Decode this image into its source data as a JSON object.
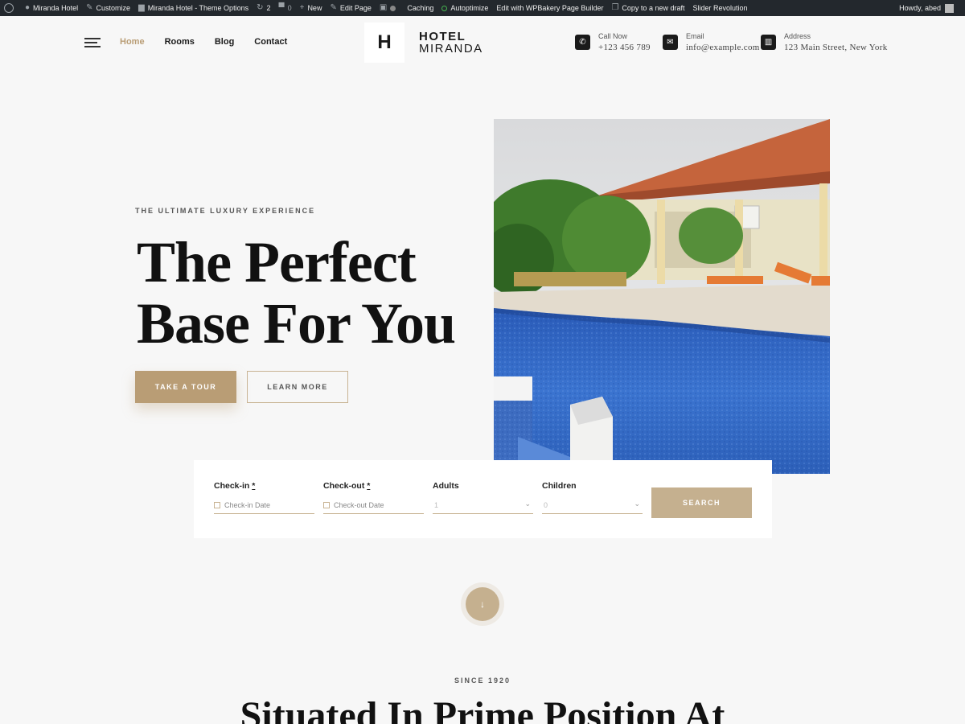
{
  "adminbar": {
    "site": "Miranda Hotel",
    "customize": "Customize",
    "theme_options": "Miranda Hotel - Theme Options",
    "updates": "2",
    "comments": "0",
    "new": "New",
    "edit_page": "Edit Page",
    "caching": "Caching",
    "autoptimize": "Autoptimize",
    "wpbakery": "Edit with WPBakery Page Builder",
    "copy_draft": "Copy to a new draft",
    "slider": "Slider Revolution",
    "howdy": "Howdy, abed"
  },
  "nav": {
    "items": [
      "Home",
      "Rooms",
      "Blog",
      "Contact"
    ]
  },
  "logo": {
    "letter": "H",
    "line1": "HOTEL",
    "line2": "MIRANDA"
  },
  "contact": {
    "phone": {
      "label": "Call Now",
      "value": "+123 456 789",
      "icon": "phone-icon"
    },
    "email": {
      "label": "Email",
      "value": "info@example.com",
      "icon": "envelope-icon"
    },
    "address": {
      "label": "Address",
      "value": "123 Main Street, New York",
      "icon": "map-icon"
    }
  },
  "hero": {
    "tagline": "THE ULTIMATE LUXURY EXPERIENCE",
    "title_line1": "The Perfect",
    "title_line2": "Base For You",
    "btn_tour": "TAKE A TOUR",
    "btn_learn": "LEARN MORE"
  },
  "booking": {
    "checkin_label": "Check-in",
    "checkin_placeholder": "Check-in Date",
    "checkout_label": "Check-out",
    "checkout_placeholder": "Check-out Date",
    "required_mark": "*",
    "adults_label": "Adults",
    "adults_value": "1",
    "children_label": "Children",
    "children_value": "0",
    "search": "SEARCH"
  },
  "section": {
    "since": "SINCE 1920",
    "title": "Situated In Prime Position At"
  },
  "colors": {
    "accent": "#b99d75",
    "adminbar": "#23282d",
    "background": "#f7f7f7"
  }
}
